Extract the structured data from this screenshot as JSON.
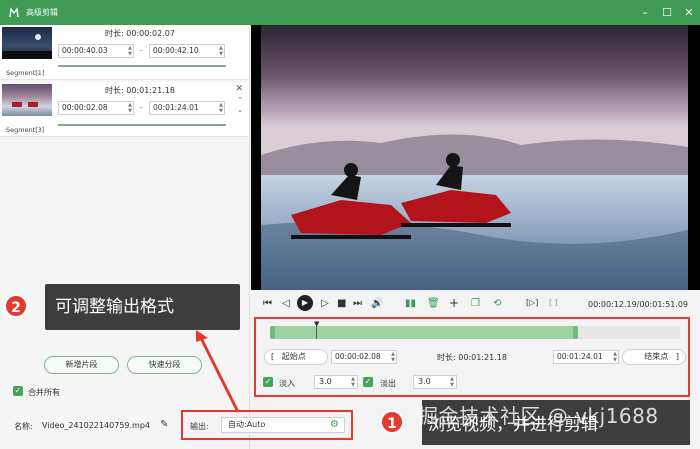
{
  "window": {
    "title": "高级剪辑",
    "controls": [
      "minimize",
      "maximize",
      "close"
    ]
  },
  "segments": [
    {
      "label": "Segment[1]",
      "duration_label": "时长:",
      "duration": "00:00:02.07",
      "start": "00:00:40.03",
      "end": "00:00:42.10"
    },
    {
      "label": "Segment[3]",
      "duration_label": "时长:",
      "duration": "00:01:21.18",
      "start": "00:00:02.08",
      "end": "00:01:24.01"
    }
  ],
  "left_buttons": {
    "new_segment": "新增片段",
    "quick_split": "快速分段"
  },
  "merge_all": {
    "label": "合并所有",
    "checked": true
  },
  "file": {
    "name_label": "名称:",
    "name": "Video_241022140759.mp4"
  },
  "output": {
    "label": "输出:",
    "value": "自动:Auto"
  },
  "callout2": {
    "number": "2",
    "text": "可调整输出格式"
  },
  "callout1": {
    "number": "1",
    "text": "浏览视频，并进行剪辑"
  },
  "watermark": "掘金技术社区 @ vkj1688",
  "playback": {
    "current": "00:00:12.19",
    "total": "00:01:51.09",
    "time_display": "00:00:12.19/00:01:51.09"
  },
  "trim": {
    "start_button": "起始点",
    "start": "00:00:02.08",
    "duration_label": "时长:",
    "duration": "00:01:21.18",
    "end": "00:01:24.01",
    "end_button": "结束点",
    "left_bracket": "[",
    "right_bracket": "]"
  },
  "fade": {
    "fade_in_label": "淡入",
    "fade_in": "3.0",
    "fade_out_label": "淡出",
    "fade_out": "3.0"
  },
  "icons": {
    "skip_start": "⏮",
    "prev_frame": "◁",
    "play": "▶",
    "next_frame": "▷",
    "stop": "■",
    "skip_end": "⏭",
    "volume": "🔊",
    "split": "▮▮",
    "delete": "🗑",
    "add": "+",
    "copy": "❐",
    "undo": "⟲",
    "mark_in": "[▷]",
    "mark_out": "[ ]",
    "edit": "✎",
    "gear": "⚙",
    "close": "✕"
  },
  "colors": {
    "accent": "#3f9a54",
    "red_annotation": "#e23b2e",
    "timeline_selection": "#9fd3a5"
  }
}
